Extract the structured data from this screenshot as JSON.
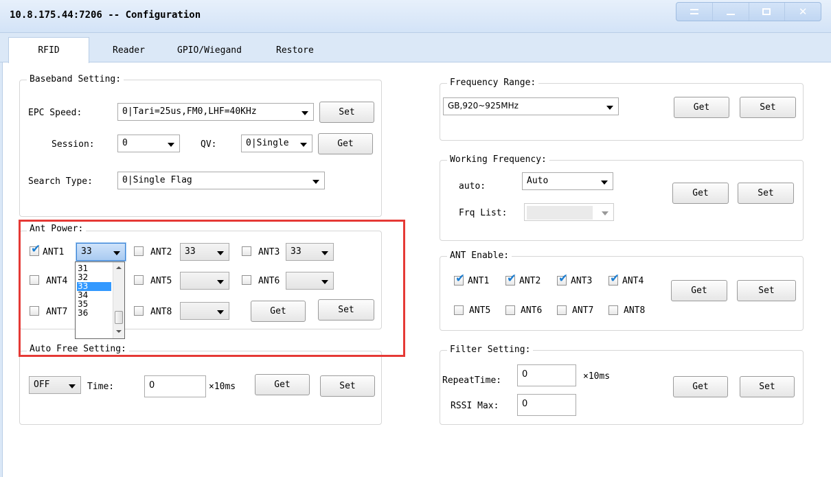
{
  "window": {
    "title": "10.8.175.44:7206 -- Configuration"
  },
  "tabs": [
    "RFID",
    "Reader",
    "GPIO/Wiegand",
    "Restore"
  ],
  "baseband": {
    "legend": "Baseband Setting:",
    "epc_label": "EPC Speed:",
    "epc_value": "0|Tari=25us,FM0,LHF=40KHz",
    "session_label": "Session:",
    "session_value": "0",
    "qv_label": "QV:",
    "qv_value": "0|Single",
    "search_label": "Search Type:",
    "search_value": "0|Single Flag",
    "set_label": "Set",
    "get_label": "Get"
  },
  "ant_power": {
    "legend": "Ant Power:",
    "ant1": "ANT1",
    "ant1_value": "33",
    "ant1_checked": true,
    "ant2": "ANT2",
    "ant2_value": "33",
    "ant3": "ANT3",
    "ant3_value": "33",
    "ant4": "ANT4",
    "ant5": "ANT5",
    "ant6": "ANT6",
    "ant7": "ANT7",
    "ant8": "ANT8",
    "dropdown_options": [
      "31",
      "32",
      "33",
      "34",
      "35",
      "36"
    ],
    "dropdown_selected": "33",
    "get_label": "Get",
    "set_label": "Set"
  },
  "auto_free": {
    "legend": "Auto Free Setting:",
    "mode_value": "OFF",
    "time_label": "Time:",
    "time_value": "0",
    "unit": "×10ms",
    "get_label": "Get",
    "set_label": "Set"
  },
  "freq_range": {
    "legend": "Frequency Range:",
    "value": "GB,920~925MHz",
    "get_label": "Get",
    "set_label": "Set"
  },
  "working_freq": {
    "legend": "Working Frequency:",
    "auto_label": "auto:",
    "auto_value": "Auto",
    "frq_label": "Frq List:",
    "get_label": "Get",
    "set_label": "Set"
  },
  "ant_enable": {
    "legend": "ANT Enable:",
    "ants": [
      "ANT1",
      "ANT2",
      "ANT3",
      "ANT4",
      "ANT5",
      "ANT6",
      "ANT7",
      "ANT8"
    ],
    "checked": [
      true,
      true,
      true,
      true,
      false,
      false,
      false,
      false
    ],
    "get_label": "Get",
    "set_label": "Set"
  },
  "filter": {
    "legend": "Filter Setting:",
    "repeat_label": "RepeatTime:",
    "repeat_value": "0",
    "unit": "×10ms",
    "rssi_label": "RSSI Max:",
    "rssi_value": "0",
    "get_label": "Get",
    "set_label": "Set"
  },
  "colors": {
    "highlight": "#e53935",
    "check": "#1f7fd1",
    "selection": "#3399ff"
  }
}
